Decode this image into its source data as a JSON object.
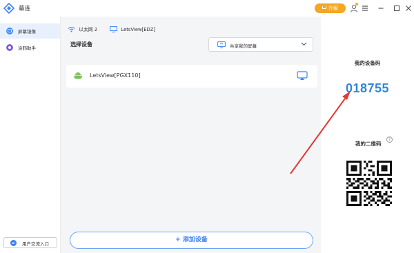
{
  "app": {
    "name": "幕连",
    "upgrade_label": "升级"
  },
  "sidebar": {
    "items": [
      {
        "label": "屏幕镜像",
        "active": true,
        "icon": "screen-mirror-icon",
        "color": "#3b82f6"
      },
      {
        "label": "涂鸦助手",
        "active": false,
        "icon": "doodle-icon",
        "color": "#7c5cd6"
      }
    ],
    "feedback_label": "用户交流入口"
  },
  "main": {
    "network": {
      "wifi_name": "以太网 2",
      "pc_name": "LetsView[EDZ]"
    },
    "section_title": "选择设备",
    "share_select": {
      "value": "共享我的屏幕"
    },
    "devices": [
      {
        "name": "LetsView[PGX110]",
        "icon": "android-icon"
      }
    ],
    "add_device_label": "+ 添加设备"
  },
  "right": {
    "code_label": "我的设备码",
    "code_value": "018755",
    "qr_label": "我的二维码",
    "help_label": "?"
  },
  "colors": {
    "accent": "#3b82f6",
    "code": "#2e86de",
    "upgrade": "#f5a623",
    "annotation_arrow": "#e53935"
  }
}
